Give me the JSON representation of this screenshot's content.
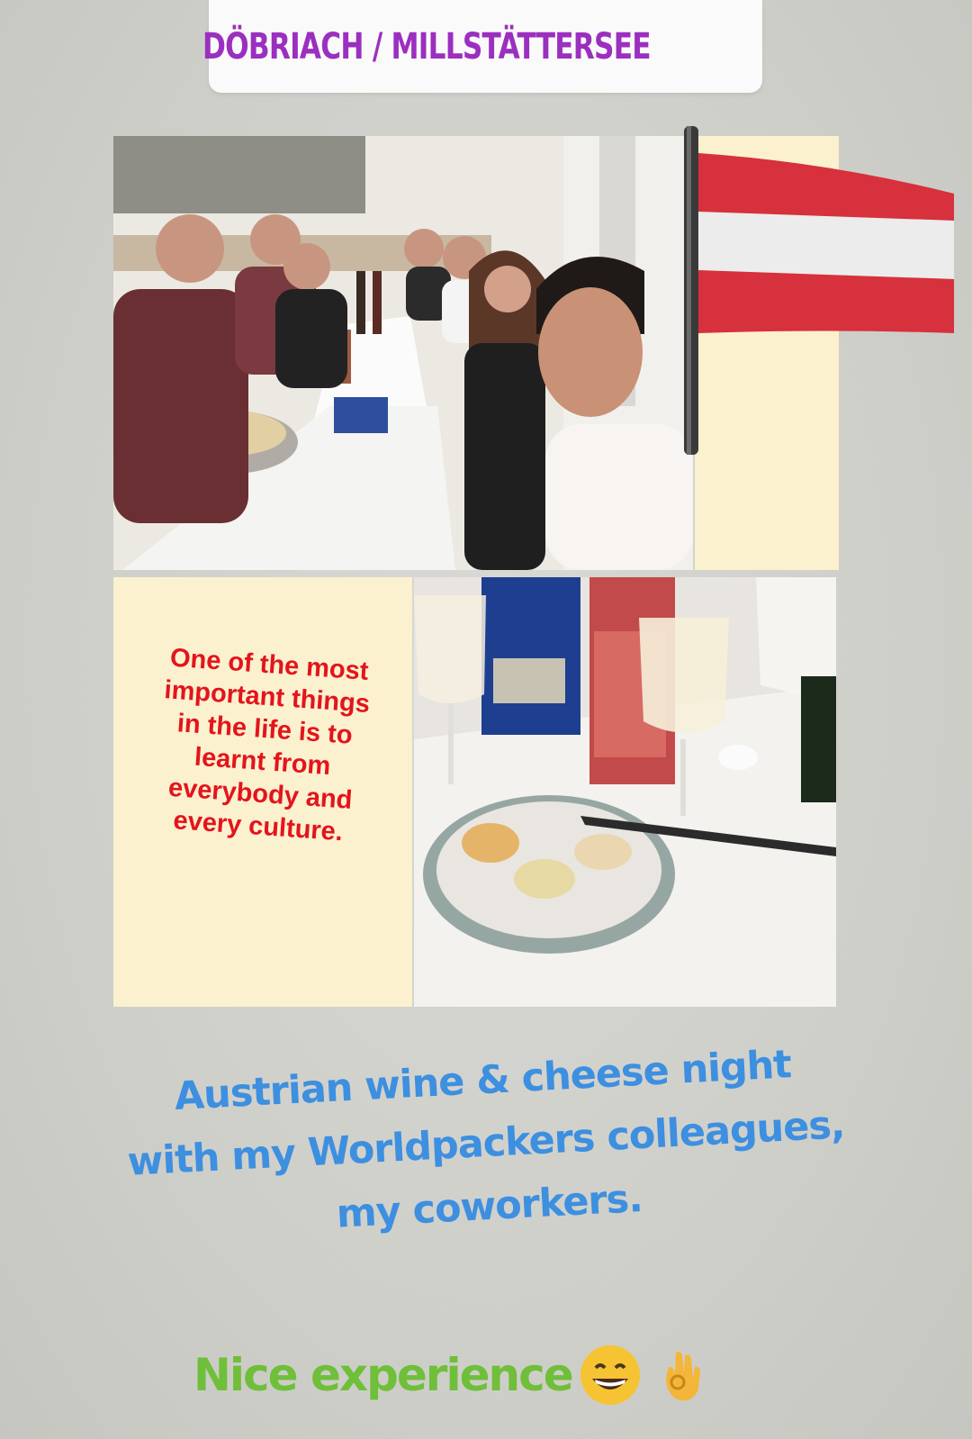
{
  "location": {
    "label": "DÖBRIACH / MILLSTÄTTERSEE",
    "icon": "location-pin-icon",
    "color": "#9b2fbf"
  },
  "photos": {
    "group_photo": "group-dinner-photo",
    "food_photo": "wine-and-cheese-photo"
  },
  "quote": {
    "text": "One of the most\nimportant things\nin the life is to\nlearnt from\neverybody and\nevery culture.",
    "color": "#e4141c"
  },
  "caption": {
    "line1": "Austrian wine & cheese night",
    "line2": "with my Worldpackers colleagues,",
    "line3": "my coworkers.",
    "color": "#3d8fe0"
  },
  "footer": {
    "text": "Nice experience",
    "color": "#6fbf3a",
    "emojis": [
      "grinning-face-icon",
      "ok-hand-icon"
    ]
  },
  "flag": {
    "name": "austria-flag-icon",
    "colors": [
      "#d6313c",
      "#f2f2f2",
      "#d6313c"
    ]
  }
}
